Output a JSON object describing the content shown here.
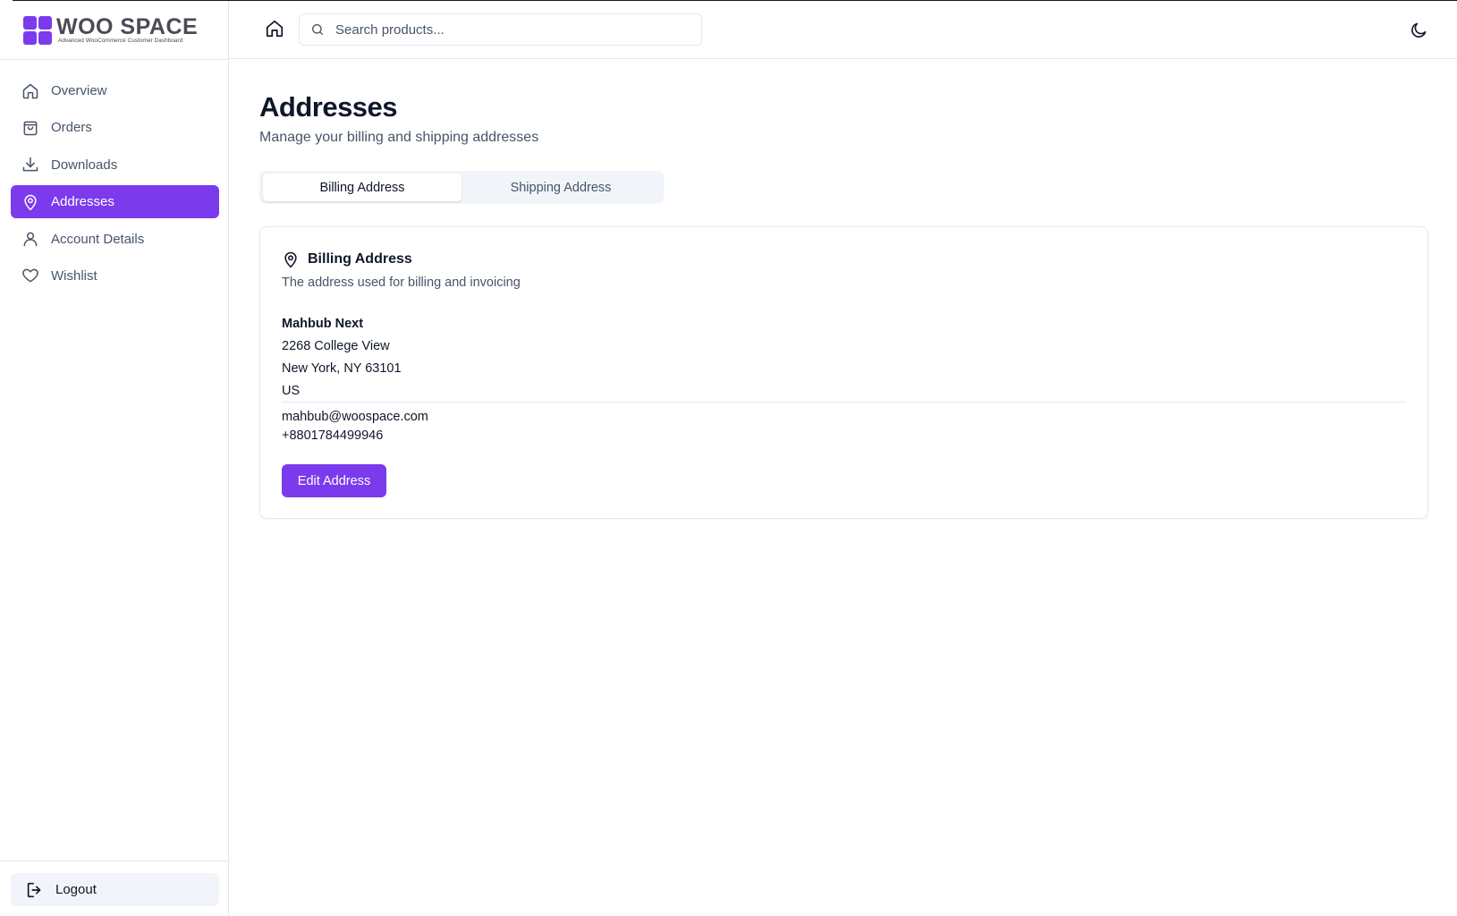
{
  "brand": {
    "name": "WOO SPACE",
    "tagline": "Advanced WooCommerce Customer Dashboard",
    "accent": "#7c3aed"
  },
  "sidebar": {
    "items": [
      {
        "label": "Overview",
        "icon": "home-icon"
      },
      {
        "label": "Orders",
        "icon": "shopping-bag-icon"
      },
      {
        "label": "Downloads",
        "icon": "download-icon"
      },
      {
        "label": "Addresses",
        "icon": "map-pin-icon",
        "active": true
      },
      {
        "label": "Account Details",
        "icon": "user-icon"
      },
      {
        "label": "Wishlist",
        "icon": "heart-icon"
      }
    ],
    "logout_label": "Logout"
  },
  "header": {
    "search_placeholder": "Search products..."
  },
  "main": {
    "title": "Addresses",
    "subtitle": "Manage your billing and shipping addresses",
    "tabs": [
      {
        "label": "Billing Address",
        "active": true
      },
      {
        "label": "Shipping Address",
        "active": false
      }
    ],
    "card": {
      "title": "Billing Address",
      "description": "The address used for billing and invoicing",
      "address": {
        "name": "Mahbub Next",
        "street": "2268 College View",
        "city_line": "New York, NY 63101",
        "country": "US"
      },
      "email": "mahbub@woospace.com",
      "phone": "+8801784499946",
      "edit_label": "Edit Address"
    }
  }
}
